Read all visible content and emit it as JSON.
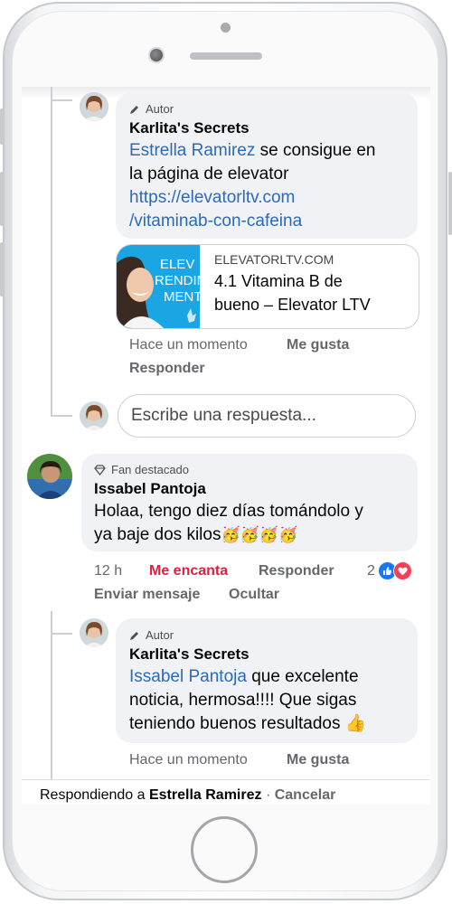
{
  "thread": {
    "reply1": {
      "badge": "Autor",
      "author": "Karlita's Secrets",
      "mention": "Estrella Ramirez",
      "line1_rest": " se consigue en",
      "line2": "la página de elevator",
      "link_line1": "https://elevatorltv.com",
      "link_line2": "/vitaminab-con-cafeina",
      "card": {
        "domain": "ELEVATORLTV.COM",
        "title_line1": "4.1 Vitamina B de",
        "title_line2": "bueno – Elevator LTV",
        "thumb_text1": "ELEV",
        "thumb_text2": "RENDIM",
        "thumb_text3": "MENT"
      },
      "time": "Hace un momento",
      "like": "Me gusta",
      "reply": "Responder"
    },
    "reply_input": {
      "placeholder": "Escribe una respuesta..."
    },
    "comment": {
      "badge": "Fan destacado",
      "author": "Issabel Pantoja",
      "line1": "Holaa, tengo diez días tomándolo y",
      "line2": "ya baje dos kilos",
      "emojis": "🥳🥳🥳🥳",
      "time": "12 h",
      "love": "Me encanta",
      "reply": "Responder",
      "message": "Enviar mensaje",
      "hide": "Ocultar",
      "reaction_count": "2",
      "colors": {
        "love": "#e41e3f",
        "like_react": "#1877f2",
        "love_react": "#f33e58"
      }
    },
    "reply2": {
      "badge": "Autor",
      "author": "Karlita's Secrets",
      "mention": "Issabel Pantoja",
      "line1_rest": " que excelente",
      "line2": "noticia, hermosa!!!! Que sigas",
      "line3": "teniendo buenos resultados",
      "emoji": "👍",
      "time": "Hace un momento",
      "like": "Me gusta"
    },
    "footer": {
      "prefix": "Respondiendo a ",
      "name": "Estrella Ramirez",
      "separator": " · ",
      "cancel": "Cancelar"
    }
  },
  "icons": {
    "author_badge": "pencil-icon",
    "fan_badge": "diamond-icon",
    "like_reaction": "thumbs-up-icon",
    "love_reaction": "heart-icon"
  },
  "colors": {
    "link": "#2b6bb8",
    "bubble": "#f0f2f5",
    "meta": "#65676b"
  }
}
